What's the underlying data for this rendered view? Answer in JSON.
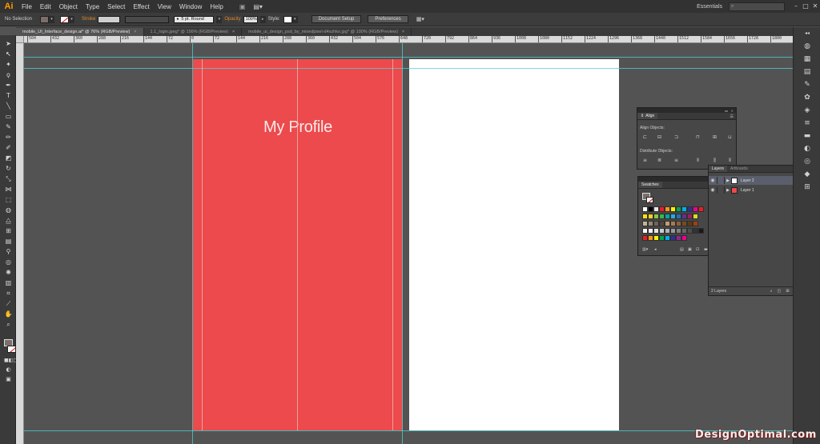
{
  "app": {
    "logo": "Ai"
  },
  "menu": [
    "File",
    "Edit",
    "Object",
    "Type",
    "Select",
    "Effect",
    "View",
    "Window",
    "Help"
  ],
  "workspace": "Essentials",
  "window_controls": [
    "–",
    "□",
    "✕"
  ],
  "control_bar": {
    "selection": "No Selection",
    "stroke_label": "Stroke",
    "brush_value": "5 pt. Round",
    "opacity_label": "Opacity",
    "opacity_value": "100%",
    "style_label": "Style:",
    "document_setup": "Document Setup",
    "preferences": "Preferences"
  },
  "tabs": [
    {
      "label": "mobile_UI_Interface_design.ai* @ 76% (RGB/Preview)",
      "active": true
    },
    {
      "label": "1.1_login.jpeg* @ 156% (RGB/Preview)",
      "active": false
    },
    {
      "label": "mobile_ui_design_psd_by_mixedpixel-d4xzhko.jpg* @ 100% (RGB/Preview)",
      "active": false
    }
  ],
  "ruler_labels": [
    "504",
    "432",
    "360",
    "288",
    "216",
    "144",
    "72",
    "0",
    "72",
    "144",
    "216",
    "288",
    "360",
    "432",
    "504",
    "576",
    "648",
    "720",
    "792",
    "864",
    "936",
    "1008",
    "1080",
    "1152",
    "1224",
    "1296",
    "1368",
    "1440",
    "1512",
    "1584",
    "1656",
    "1728",
    "1800"
  ],
  "artboard": {
    "title": "My Profile"
  },
  "align_panel": {
    "tab": "Align",
    "align_objects": "Align Objects:",
    "distribute_objects": "Distribute Objects:"
  },
  "swatches_panel": {
    "tab": "Swatches"
  },
  "layers_panel": {
    "tabs": [
      "Layers",
      "Artboards"
    ],
    "layers": [
      {
        "name": "Layer 2",
        "selected": true
      },
      {
        "name": "Layer 1",
        "selected": false
      }
    ],
    "footer": "2 Layers"
  },
  "swatch_colors": [
    [
      "#ffffff",
      "#000000",
      "#e8e8e8",
      "#ed1c24",
      "#f7941d",
      "#fff200",
      "#00a651",
      "#00aeef",
      "#2e3192",
      "#ec008c",
      "#ed1c24"
    ],
    [
      "#f6e20f",
      "#f7d21a",
      "#8dc63f",
      "#39b54a",
      "#00a99d",
      "#27aae1",
      "#1b75bb",
      "#662d91",
      "#9e1f63",
      "#d7df23"
    ],
    [
      "#c2b59b",
      "#998675",
      "#736357",
      "#534741",
      "#c69c6d",
      "#a67c52",
      "#8c6239",
      "#754c24",
      "#603913",
      "#a0410d"
    ],
    [
      "#ffffff",
      "#f1f1f1",
      "#e6e6e6",
      "#cccccc",
      "#b3b3b3",
      "#999999",
      "#808080",
      "#666666",
      "#4d4d4d",
      "#333333",
      "#1a1a1a"
    ],
    [
      "#ed1c24",
      "#f7941d",
      "#fff200",
      "#00a651",
      "#00aeef",
      "#2e3192",
      "#92278f",
      "#ec008c"
    ]
  ],
  "watermark": "DesignOptimal.com"
}
